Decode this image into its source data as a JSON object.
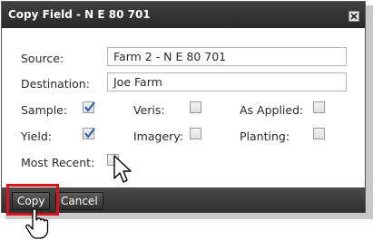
{
  "dialog": {
    "title": "Copy Field - N E 80 701",
    "close_icon": "close-icon"
  },
  "fields": {
    "source_label": "Source:",
    "source_value": "Farm 2 - N E 80  701",
    "destination_label": "Destination:",
    "destination_value": "Joe Farm"
  },
  "options": {
    "sample": {
      "label": "Sample:",
      "checked": true
    },
    "yield": {
      "label": "Yield:",
      "checked": true
    },
    "veris": {
      "label": "Veris:",
      "checked": false
    },
    "imagery": {
      "label": "Imagery:",
      "checked": false
    },
    "as_applied": {
      "label": "As Applied:",
      "checked": false
    },
    "planting": {
      "label": "Planting:",
      "checked": false
    },
    "most_recent": {
      "label": "Most Recent:",
      "checked": false
    }
  },
  "buttons": {
    "copy": "Copy",
    "cancel": "Cancel"
  },
  "colors": {
    "titlebar": "#333333",
    "check": "#2f5fb3",
    "highlight": "#d9141b"
  }
}
